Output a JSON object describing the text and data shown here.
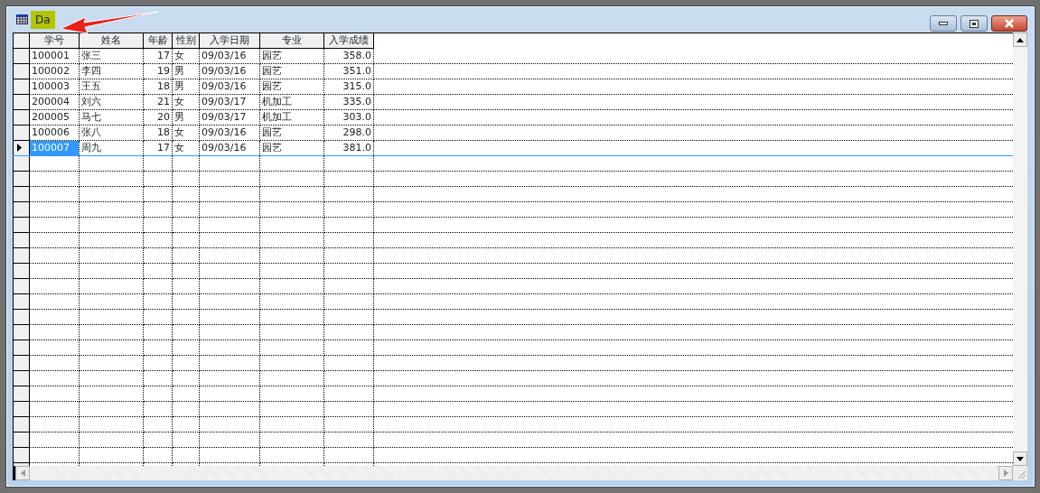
{
  "window": {
    "title": "Da"
  },
  "table": {
    "columns": [
      {
        "label": "学号",
        "kind": "text"
      },
      {
        "label": "姓名",
        "kind": "text"
      },
      {
        "label": "年龄",
        "kind": "number"
      },
      {
        "label": "性别",
        "kind": "text"
      },
      {
        "label": "入学日期",
        "kind": "text"
      },
      {
        "label": "专业",
        "kind": "text"
      },
      {
        "label": "入学成绩",
        "kind": "number"
      }
    ],
    "rows": [
      {
        "cells": [
          "100001",
          "张三",
          "17",
          "女",
          "09/03/16",
          "园艺",
          "358.0"
        ],
        "selected": false
      },
      {
        "cells": [
          "100002",
          "李四",
          "19",
          "男",
          "09/03/16",
          "园艺",
          "351.0"
        ],
        "selected": false
      },
      {
        "cells": [
          "100003",
          "王五",
          "18",
          "男",
          "09/03/16",
          "园艺",
          "315.0"
        ],
        "selected": false
      },
      {
        "cells": [
          "200004",
          "刘六",
          "21",
          "女",
          "09/03/17",
          "机加工",
          "335.0"
        ],
        "selected": false
      },
      {
        "cells": [
          "200005",
          "马七",
          "20",
          "男",
          "09/03/17",
          "机加工",
          "303.0"
        ],
        "selected": false
      },
      {
        "cells": [
          "100006",
          "张八",
          "18",
          "女",
          "09/03/16",
          "园艺",
          "298.0"
        ],
        "selected": false
      },
      {
        "cells": [
          "100007",
          "周九",
          "17",
          "女",
          "09/03/16",
          "园艺",
          "381.0"
        ],
        "selected": true
      }
    ]
  }
}
